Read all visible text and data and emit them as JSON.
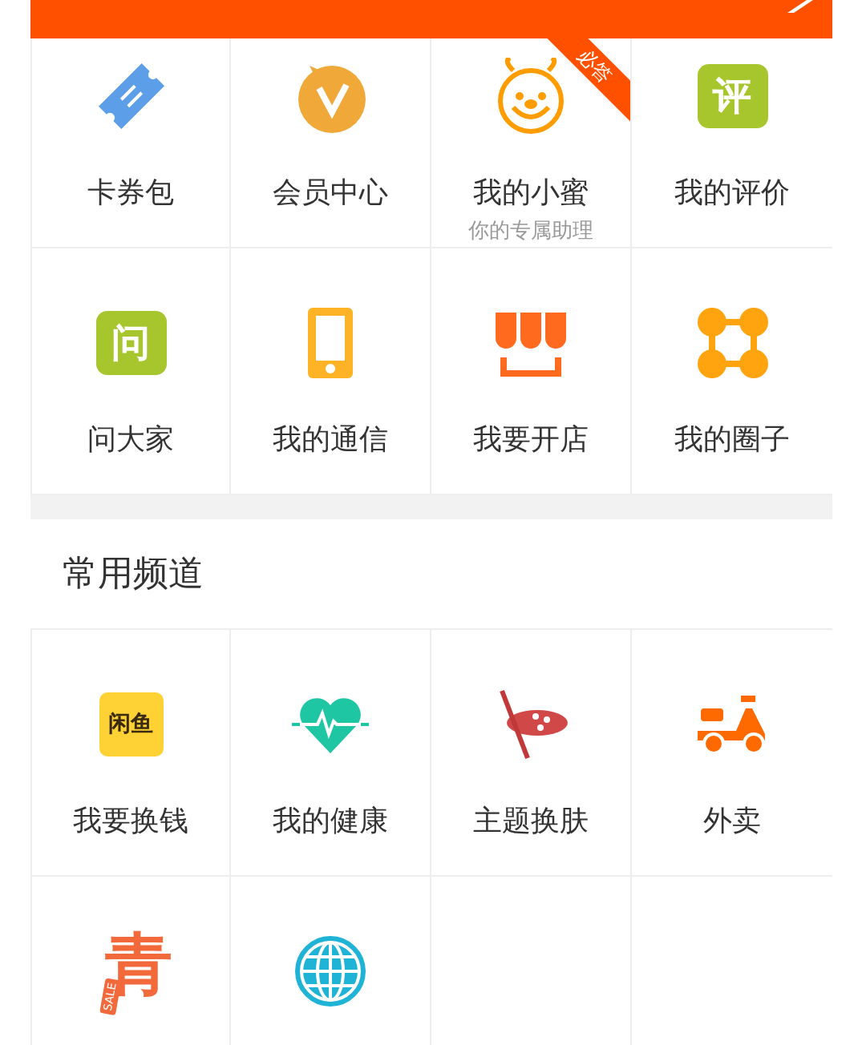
{
  "sections": [
    {
      "cells": [
        {
          "kind": "ticket",
          "label": "卡券包"
        },
        {
          "kind": "vip",
          "label": "会员中心"
        },
        {
          "kind": "bee",
          "label": "我的小蜜",
          "sublabel": "你的专属助理",
          "ribbon": "必答"
        },
        {
          "kind": "bubble-green",
          "label": "我的评价",
          "icon_text": "评"
        },
        {
          "kind": "bubble-green",
          "label": "问大家",
          "icon_text": "问"
        },
        {
          "kind": "phone",
          "label": "我的通信"
        },
        {
          "kind": "shop",
          "label": "我要开店"
        },
        {
          "kind": "circle-group",
          "label": "我的圈子"
        }
      ]
    },
    {
      "title": "常用频道",
      "cells": [
        {
          "kind": "yellow-logo",
          "label": "我要换钱",
          "icon_text": "闲鱼"
        },
        {
          "kind": "heart",
          "label": "我的健康"
        },
        {
          "kind": "palette",
          "label": "主题换肤"
        },
        {
          "kind": "scooter",
          "label": "外卖"
        },
        {
          "kind": "sale-tag",
          "icon_text": "青",
          "tag_text": "SALE"
        },
        {
          "kind": "globe"
        },
        {
          "kind": "empty"
        },
        {
          "kind": "empty"
        }
      ]
    }
  ]
}
